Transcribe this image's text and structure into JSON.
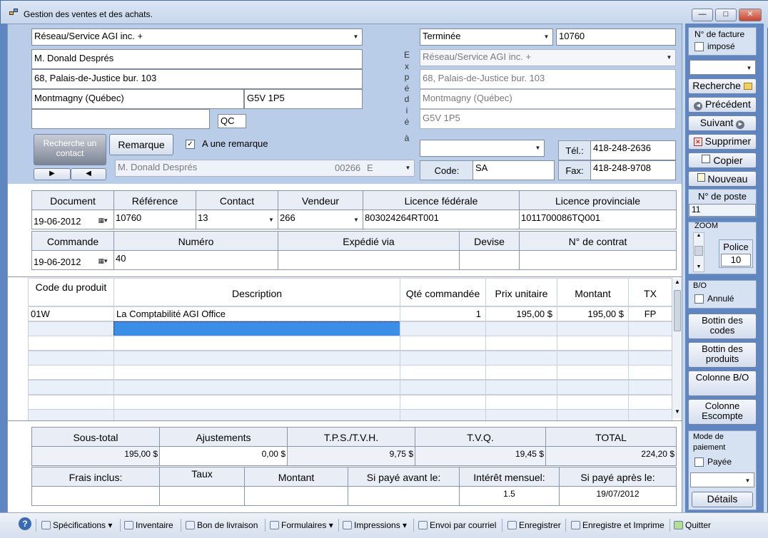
{
  "window": {
    "title": "Gestion des ventes et des achats.",
    "controls": [
      "—",
      "□",
      "✕"
    ]
  },
  "customer": {
    "company": "Réseau/Service AGI inc.  +",
    "contact": "M. Donald Després",
    "address": "68, Palais-de-Justice bur. 103",
    "city": "Montmagny (Québec)",
    "postal": "G5V 1P5",
    "province": "QC",
    "remark_button": "Remarque",
    "has_remark_label": "A une remarque",
    "has_remark": true,
    "search_contact_label": "Recherche un contact",
    "contact_line": {
      "name": "M. Donald Després",
      "code": "00266",
      "type": "E"
    }
  },
  "shipping": {
    "vertical_label": "Expédié à",
    "status": "Terminée",
    "invoice_number": "10760",
    "company": "Réseau/Service AGI inc.  +",
    "address": "68, Palais-de-Justice bur. 103",
    "city": "Montmagny (Québec)",
    "postal": "G5V 1P5",
    "code_label": "Code:",
    "code_value": "SA",
    "tel_label": "Tél.:",
    "tel_value": "418-248-2636",
    "fax_label": "Fax:",
    "fax_value": "418-248-9708"
  },
  "doc_header": {
    "row1_headers": [
      "Document",
      "Référence",
      "Contact",
      "Vendeur",
      "Licence fédérale",
      "Licence provinciale"
    ],
    "row1_values": [
      "19-06-2012",
      "10760",
      "13",
      "266",
      "803024264RT001",
      "1011700086TQ001"
    ],
    "row2_headers": [
      "Commande",
      "Numéro",
      "Expédié via",
      "Devise",
      "N° de contrat"
    ],
    "row2_values": [
      "19-06-2012",
      "40",
      "",
      "",
      ""
    ]
  },
  "items": {
    "headers": [
      "Code du produit",
      "Description",
      "Qté commandée",
      "Prix unitaire",
      "Montant",
      "TX"
    ],
    "rows": [
      [
        "01W",
        "La Comptabilité AGI Office",
        "1",
        "195,00 $",
        "195,00 $",
        "FP"
      ]
    ]
  },
  "totals": {
    "headers": [
      "Sous-total",
      "Ajustements",
      "T.P.S./T.V.H.",
      "T.V.Q.",
      "TOTAL"
    ],
    "values": [
      "195,00 $",
      "0,00 $",
      "9,75 $",
      "19,45 $",
      "224,20 $"
    ],
    "row2_headers": [
      "Frais inclus:",
      "Taux",
      "Montant",
      "Si payé avant le:",
      "Intérêt mensuel:",
      "Si payé après le:"
    ],
    "row2_values": [
      "",
      "",
      "",
      "",
      "1.5",
      "19/07/2012"
    ]
  },
  "sidebar": {
    "invoice_number_label": "N° de facture",
    "imposed_label": "imposé",
    "search": "Recherche",
    "previous": "Précédent",
    "next": "Suivant",
    "delete": "Supprimer",
    "copy": "Copier",
    "new": "Nouveau",
    "post_label": "N° de poste",
    "post_value": "11",
    "zoom_label": "ZOOM",
    "font_label": "Police",
    "font_value": "10",
    "bo_label": "B/O",
    "cancelled_label": "Annulé",
    "codes_directory": "Bottin des codes",
    "products_directory": "Bottin des produits",
    "bo_column": "Colonne B/O",
    "discount_column": "Colonne Escompte",
    "payment_mode_label": "Mode de paiement",
    "paid_label": "Payée",
    "details": "Détails"
  },
  "statusbar": {
    "items": [
      "Spécifications",
      "Inventaire",
      "Bon de livraison",
      "Formulaires",
      "Impressions",
      "Envoi par courriel",
      "Enregistrer",
      "Enregistre et Imprime",
      "Quitter"
    ]
  }
}
